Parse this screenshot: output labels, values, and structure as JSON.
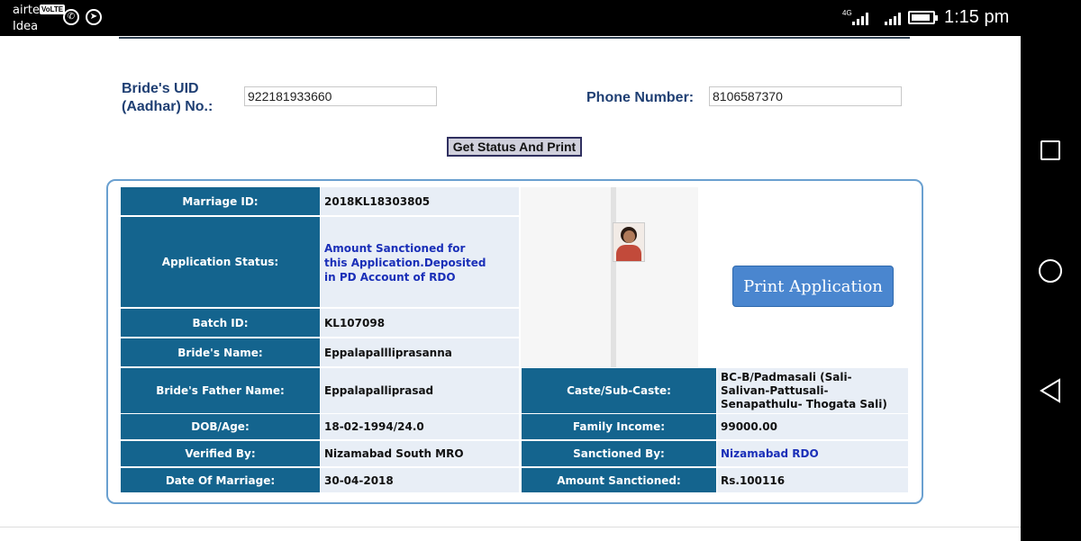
{
  "status_bar": {
    "carrier_primary": "airtel",
    "carrier_badge": "VoLTE",
    "carrier_secondary": "Idea",
    "network_label": "4G",
    "time": "1:15 pm"
  },
  "form": {
    "uid_label_line1": "Bride's UID",
    "uid_label_line2": "(Aadhar) No.:",
    "uid_value": "922181933660",
    "phone_label": "Phone Number:",
    "phone_value": "8106587370",
    "submit_label": "Get Status And Print"
  },
  "details": {
    "marriage_id": {
      "label": "Marriage ID:",
      "value": "2018KL18303805"
    },
    "application_status": {
      "label": "Application Status:",
      "value": "Amount Sanctioned for this Application.Deposited in PD Account of RDO"
    },
    "batch_id": {
      "label": "Batch ID:",
      "value": "KL107098"
    },
    "brides_name": {
      "label": "Bride's Name:",
      "value": "Eppalapallliprasanna"
    },
    "brides_father_name": {
      "label": "Bride's Father Name:",
      "value": "Eppalapalliprasad"
    },
    "dob_age": {
      "label": "DOB/Age:",
      "value": "18-02-1994/24.0"
    },
    "verified_by": {
      "label": "Verified By:",
      "value": "Nizamabad South MRO"
    },
    "date_of_marriage": {
      "label": "Date Of Marriage:",
      "value": "30-04-2018"
    },
    "caste": {
      "label": "Caste/Sub-Caste:",
      "value": "BC-B/Padmasali (Sali- Salivan-Pattusali- Senapathulu- Thogata Sali)"
    },
    "family_income": {
      "label": "Family Income:",
      "value": "99000.00"
    },
    "sanctioned_by": {
      "label": "Sanctioned By:",
      "value": "Nizamabad RDO"
    },
    "amount_sanctioned": {
      "label": "Amount Sanctioned:",
      "value": "Rs.100116"
    }
  },
  "print_button_label": "Print Application",
  "colors": {
    "header_cell": "#14648e",
    "value_cell": "#e8eef6",
    "label_text": "#1f3f73",
    "link_text": "#1a2fb8",
    "print_button": "#4a86cf"
  },
  "icons": [
    "whatsapp-icon",
    "telegram-icon",
    "signal-icon",
    "battery-icon",
    "square-nav-icon",
    "circle-nav-icon",
    "back-nav-icon"
  ]
}
